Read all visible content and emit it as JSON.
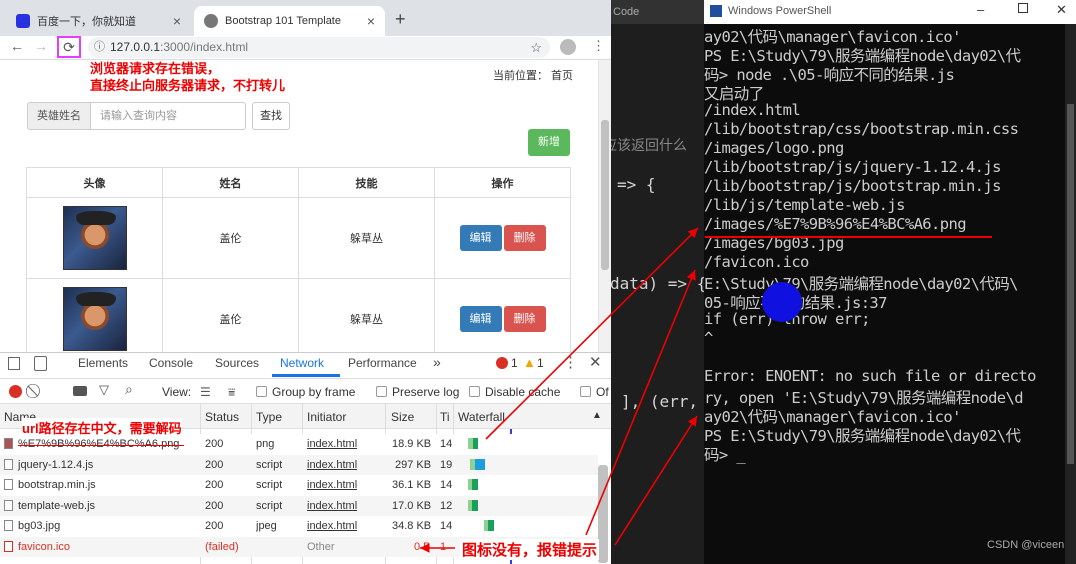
{
  "browser": {
    "tabs": [
      {
        "title": "百度一下，你就知道"
      },
      {
        "title": "Bootstrap 101 Template"
      }
    ],
    "new_tab": "+",
    "url_host": "127.0.0.1",
    "url_path": ":3000/index.html"
  },
  "page": {
    "breadcrumb": "当前位置：  首页",
    "search_label": "英雄姓名",
    "search_placeholder": "请输入查询内容",
    "search_button": "查找",
    "add_button": "新增",
    "table_headers": [
      "头像",
      "姓名",
      "技能",
      "操作"
    ],
    "rows": [
      {
        "name": "盖伦",
        "skill": "躲草丛",
        "edit": "编辑",
        "delete": "删除"
      },
      {
        "name": "盖伦",
        "skill": "躲草丛",
        "edit": "编辑",
        "delete": "删除"
      }
    ]
  },
  "devtools": {
    "tabs": [
      "Elements",
      "Console",
      "Sources",
      "Network",
      "Performance"
    ],
    "more": "»",
    "errors": "1",
    "warnings": "1",
    "view_label": "View:",
    "options": [
      "Group by frame",
      "Preserve log",
      "Disable cache",
      "Of"
    ],
    "columns": [
      "Name",
      "Status",
      "Type",
      "Initiator",
      "Size",
      "Ti",
      "Waterfall"
    ],
    "requests": [
      {
        "name": "%E7%9B%96%E4%BC%A6.png",
        "status": "200",
        "type": "png",
        "initiator": "index.html",
        "size": "18.9 KB",
        "time": "14"
      },
      {
        "name": "jquery-1.12.4.js",
        "status": "200",
        "type": "script",
        "initiator": "index.html",
        "size": "297 KB",
        "time": "19"
      },
      {
        "name": "bootstrap.min.js",
        "status": "200",
        "type": "script",
        "initiator": "index.html",
        "size": "36.1 KB",
        "time": "14"
      },
      {
        "name": "template-web.js",
        "status": "200",
        "type": "script",
        "initiator": "index.html",
        "size": "17.0 KB",
        "time": "12"
      },
      {
        "name": "bg03.jpg",
        "status": "200",
        "type": "jpeg",
        "initiator": "index.html",
        "size": "34.8 KB",
        "time": "14"
      },
      {
        "name": "favicon.ico",
        "status": "(failed)",
        "type": "",
        "initiator": "Other",
        "size": "0 B",
        "time": "1"
      }
    ]
  },
  "annotations": {
    "browser_error": "浏览器请求存在错误，",
    "browser_error2": "直接终止向服务器请求，不打转儿",
    "url_chinese": "url路径存在中文，需要解码",
    "icon_missing": "图标没有，报错提示"
  },
  "editor": {
    "title": "Code",
    "lines": [
      "应该返回什么",
      "=> {",
      "data) => {",
      "], (err,"
    ]
  },
  "powershell": {
    "title": "Windows PowerShell",
    "lines": [
      "ay02\\代码\\manager\\favicon.ico'",
      "PS E:\\Study\\79\\服务端编程node\\day02\\代",
      "码> node .\\05-响应不同的结果.js",
      "又启动了",
      "/index.html",
      "/lib/bootstrap/css/bootstrap.min.css",
      "/images/logo.png",
      "/lib/bootstrap/js/jquery-1.12.4.js",
      "/lib/bootstrap/js/bootstrap.min.js",
      "/lib/js/template-web.js",
      "/images/%E7%9B%96%E4%BC%A6.png",
      "/images/bg03.jpg",
      "/favicon.ico",
      "E:\\Study\\79\\服务端编程node\\day02\\代码\\",
      "05-响应不同的结果.js:37",
      "        if (err) throw err;",
      "                  ^",
      "",
      "Error: ENOENT: no such file or directo",
      "ry, open 'E:\\Study\\79\\服务端编程node\\d",
      "ay02\\代码\\manager\\favicon.ico'",
      "PS E:\\Study\\79\\服务端编程node\\day02\\代",
      "码> _"
    ],
    "watermark": "CSDN @viceen"
  },
  "colors": {
    "accent_red": "#e00000",
    "btn_blue": "#337ab7",
    "btn_red": "#d9534f",
    "btn_green": "#5cb85c"
  }
}
